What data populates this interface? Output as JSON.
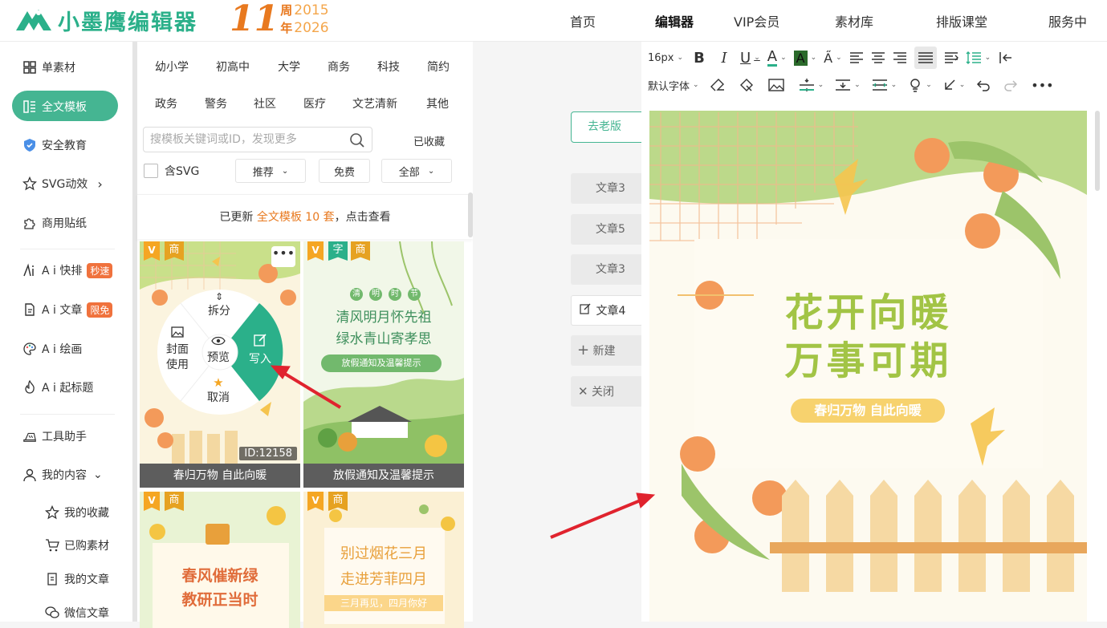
{
  "header": {
    "logo_text": "小墨鹰编辑器",
    "anniversary": {
      "number": "11",
      "line1": "周",
      "year_start": "2015",
      "line2": "年",
      "year_end": "2026"
    },
    "nav": [
      "首页",
      "编辑器",
      "VIP会员",
      "素材库",
      "排版课堂",
      "服务中"
    ]
  },
  "sidebar": {
    "items": [
      {
        "label": "单素材",
        "icon": "grid-icon"
      },
      {
        "label": "全文模板",
        "icon": "template-icon"
      },
      {
        "label": "安全教育",
        "icon": "shield-icon"
      },
      {
        "label": "SVG动效",
        "icon": "star-icon",
        "suffix": "›"
      },
      {
        "label": "商用贴纸",
        "icon": "puzzle-icon"
      },
      {
        "label": "A i 快排",
        "icon": "ai-icon",
        "badge": "秒速"
      },
      {
        "label": "A i 文章",
        "icon": "doc-icon",
        "badge": "限免"
      },
      {
        "label": "A i 绘画",
        "icon": "palette-icon"
      },
      {
        "label": "A i 起标题",
        "icon": "flame-icon"
      },
      {
        "label": "工具助手",
        "icon": "tools-icon"
      },
      {
        "label": "我的内容",
        "icon": "user-icon",
        "suffix": "⌄"
      }
    ],
    "sub_items": [
      {
        "label": "我的收藏",
        "icon": "star-outline-icon"
      },
      {
        "label": "已购素材",
        "icon": "cart-icon"
      },
      {
        "label": "我的文章",
        "icon": "file-icon"
      },
      {
        "label": "微信文章",
        "icon": "wechat-icon"
      }
    ]
  },
  "panel": {
    "categories_row1": [
      "幼小学",
      "初高中",
      "大学",
      "商务",
      "科技",
      "简约"
    ],
    "categories_row2": [
      "政务",
      "警务",
      "社区",
      "医疗",
      "文艺清新",
      "其他"
    ],
    "search_placeholder": "搜模板关键词或ID，发现更多",
    "favorites": "已收藏",
    "svg_checkbox": "含SVG",
    "sort": "推荐",
    "price": "免费",
    "scope": "全部",
    "update_prefix": "已更新",
    "update_highlight": "全文模板 10 套",
    "update_suffix": "，点击查看",
    "cards": [
      {
        "caption": "春归万物 自此向暖",
        "tags": [
          "商"
        ],
        "id": "ID:12158"
      },
      {
        "caption": "放假通知及温馨提示",
        "tags": [
          "字",
          "商"
        ],
        "title1": "清风明月怀先祖",
        "title2": "绿水青山寄孝思",
        "sub": "放假通知及温馨提示",
        "top_tags": [
          "清",
          "明",
          "时",
          "节"
        ]
      },
      {
        "caption": "",
        "tags": [
          "商"
        ],
        "title1": "春风催新绿",
        "title2": "教研正当时"
      },
      {
        "caption": "",
        "tags": [
          "商"
        ],
        "title1": "别过烟花三月",
        "title2": "走进芳菲四月",
        "sub": "三月再见，四月你好"
      }
    ],
    "radial_menu": {
      "split": "拆分",
      "cover1": "封面",
      "cover2": "使用",
      "preview": "预览",
      "write": "写入",
      "cancel": "取消"
    }
  },
  "middle": {
    "old_version": "去老版",
    "tabs": [
      "文章3",
      "文章5",
      "文章3",
      "文章4"
    ],
    "new": "新建",
    "close": "关闭"
  },
  "editor": {
    "font_size": "16px",
    "font_family": "默认字体",
    "canvas": {
      "title1": "花开向暖",
      "title2": "万事可期",
      "subtitle": "春归万物 自此向暖"
    }
  },
  "colors": {
    "accent": "#45b592",
    "brand": "#2bb08a",
    "orange": "#e8791f",
    "arrow": "#e0232e",
    "green_title": "#a2c445"
  }
}
